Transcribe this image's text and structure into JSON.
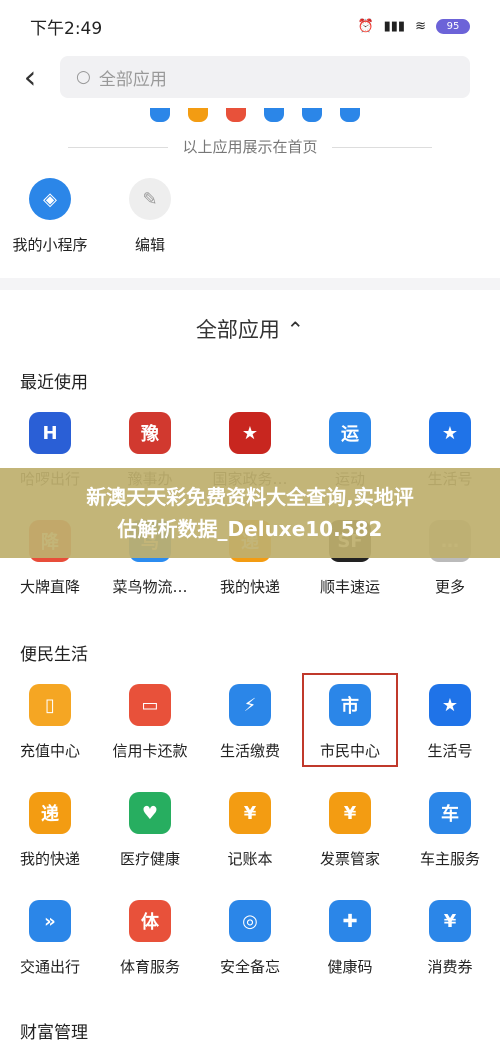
{
  "status": {
    "time": "下午2:49",
    "battery": "95"
  },
  "search": {
    "placeholder": "全部应用"
  },
  "home_section": {
    "divider": "以上应用展示在首页",
    "items": [
      {
        "label": "我的小程序",
        "icon": "mini-program-icon"
      },
      {
        "label": "编辑",
        "icon": "edit-icon"
      }
    ]
  },
  "all_apps": {
    "title": "全部应用"
  },
  "categories": {
    "recent": "最近使用",
    "life": "便民生活",
    "last": "财富管理"
  },
  "recent_row1": [
    {
      "label": "哈啰出行",
      "color": "#2a5fd6",
      "glyph": "H"
    },
    {
      "label": "豫事办",
      "color": "#d1392f",
      "glyph": "豫"
    },
    {
      "label": "国家政务…",
      "color": "#c8261f",
      "glyph": "★"
    },
    {
      "label": "运动",
      "color": "#2b86e8",
      "glyph": "运"
    },
    {
      "label": "生活号",
      "color": "#1f73e8",
      "glyph": "★"
    }
  ],
  "recent_row2": [
    {
      "label": "大牌直降",
      "color": "#e84d3a",
      "glyph": "降"
    },
    {
      "label": "菜鸟物流…",
      "color": "#2b8cf0",
      "glyph": "鸟"
    },
    {
      "label": "我的快递",
      "color": "#f39c12",
      "glyph": "递"
    },
    {
      "label": "顺丰速运",
      "color": "#222222",
      "glyph": "SF"
    },
    {
      "label": "更多",
      "color": "#bbbbbb",
      "glyph": "…"
    }
  ],
  "life_row1": [
    {
      "label": "充值中心",
      "color": "#f5a623",
      "glyph": "▯"
    },
    {
      "label": "信用卡还款",
      "color": "#e8513a",
      "glyph": "▭"
    },
    {
      "label": "生活缴费",
      "color": "#2b86e8",
      "glyph": "⚡"
    },
    {
      "label": "市民中心",
      "color": "#2b86e8",
      "glyph": "市"
    },
    {
      "label": "生活号",
      "color": "#1f73e8",
      "glyph": "★"
    }
  ],
  "life_row2": [
    {
      "label": "我的快递",
      "color": "#f39c12",
      "glyph": "递"
    },
    {
      "label": "医疗健康",
      "color": "#27ae60",
      "glyph": "♥"
    },
    {
      "label": "记账本",
      "color": "#f39c12",
      "glyph": "¥"
    },
    {
      "label": "发票管家",
      "color": "#f39c12",
      "glyph": "¥"
    },
    {
      "label": "车主服务",
      "color": "#2b86e8",
      "glyph": "车"
    }
  ],
  "life_row3": [
    {
      "label": "交通出行",
      "color": "#2b86e8",
      "glyph": "»"
    },
    {
      "label": "体育服务",
      "color": "#e8513a",
      "glyph": "体"
    },
    {
      "label": "安全备忘",
      "color": "#2b86e8",
      "glyph": "◎"
    },
    {
      "label": "健康码",
      "color": "#2b86e8",
      "glyph": "✚"
    },
    {
      "label": "消费券",
      "color": "#2b86e8",
      "glyph": "¥"
    }
  ],
  "overlay": {
    "line1": "新澳天天彩免费资料大全查询,实地评",
    "line2": "估解析数据_Deluxe10.582"
  }
}
